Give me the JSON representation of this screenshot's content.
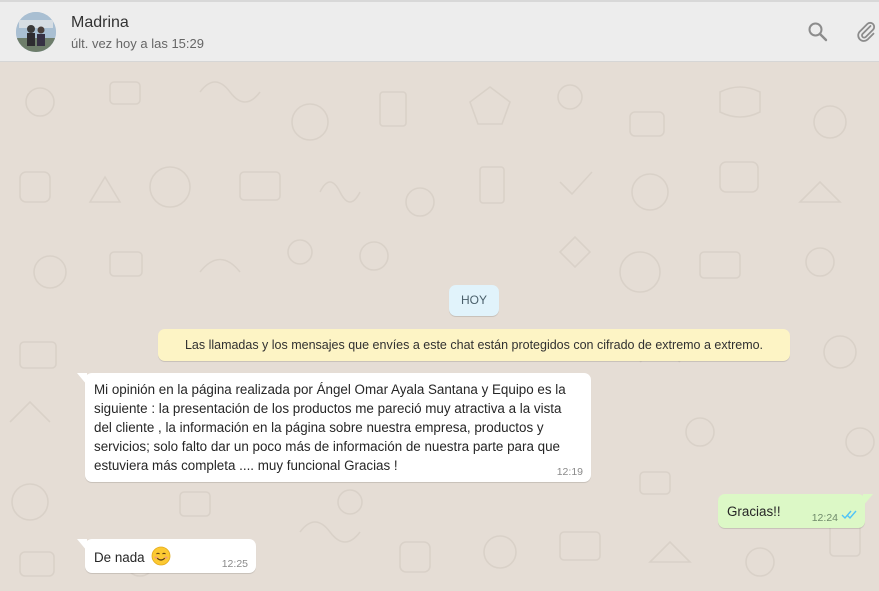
{
  "header": {
    "contact_name": "Madrina",
    "last_seen": "últ. vez hoy a las 15:29",
    "icons": [
      "search-icon",
      "paperclip-icon"
    ]
  },
  "chat": {
    "date_chip": "HOY",
    "encryption_notice": "Las llamadas y los mensajes que envíes a este chat están protegidos con cifrado de extremo a extremo.",
    "messages": [
      {
        "direction": "incoming",
        "text": "Mi opinión en la página realizada por Ángel Omar Ayala Santana y Equipo es la\nsiguiente : la presentación de los productos me pareció muy atractiva a la vista\ndel cliente , la información en la página sobre nuestra empresa, productos y\nservicios; solo falto dar un poco más de información de nuestra parte para que\nestuviera más completa .... muy funcional Gracias !",
        "time": "12:19"
      },
      {
        "direction": "outgoing",
        "text": "Gracias!!",
        "time": "12:24",
        "status_icon": "double-check-read-icon"
      },
      {
        "direction": "incoming",
        "text": "De nada",
        "emoji": "smiling-face-icon",
        "time": "12:25"
      }
    ]
  },
  "colors": {
    "chat_background": "#e5ddd5",
    "header_background": "#ededed",
    "outgoing_bubble": "#dcf8c6",
    "incoming_bubble": "#ffffff",
    "notice_background": "#fdf4c5",
    "date_chip_background": "#e1f3fb",
    "read_ticks": "#4fc3f7"
  }
}
